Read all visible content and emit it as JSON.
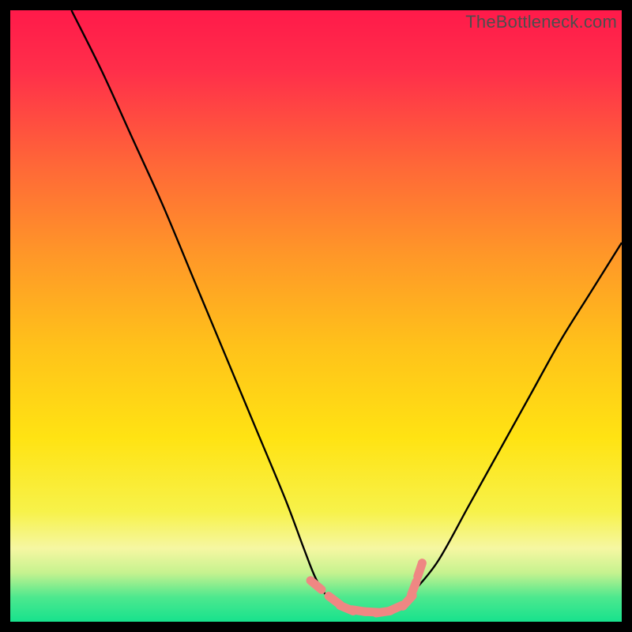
{
  "watermark": "TheBottleneck.com",
  "gradient": {
    "stops": [
      {
        "offset": 0.0,
        "color": "#ff1a4a"
      },
      {
        "offset": 0.1,
        "color": "#ff2f4a"
      },
      {
        "offset": 0.25,
        "color": "#ff6638"
      },
      {
        "offset": 0.4,
        "color": "#ff9728"
      },
      {
        "offset": 0.55,
        "color": "#ffc21a"
      },
      {
        "offset": 0.7,
        "color": "#ffe313"
      },
      {
        "offset": 0.82,
        "color": "#f7f24a"
      },
      {
        "offset": 0.88,
        "color": "#f6f7a2"
      },
      {
        "offset": 0.92,
        "color": "#c6f28f"
      },
      {
        "offset": 0.96,
        "color": "#4de88e"
      },
      {
        "offset": 1.0,
        "color": "#17e28d"
      }
    ]
  },
  "curve_color": "#000000",
  "marker_color": "#ef8783",
  "chart_data": {
    "type": "line",
    "title": "",
    "xlabel": "",
    "ylabel": "",
    "xlim": [
      0,
      100
    ],
    "ylim": [
      0,
      100
    ],
    "series": [
      {
        "name": "bottleneck-curve",
        "x": [
          10,
          15,
          20,
          25,
          30,
          35,
          40,
          45,
          48,
          50,
          52,
          55,
          58,
          60,
          62,
          64,
          66,
          70,
          75,
          80,
          85,
          90,
          95,
          100
        ],
        "y": [
          100,
          90,
          79,
          68,
          56,
          44,
          32,
          20,
          12,
          7,
          4,
          2,
          1.5,
          1.5,
          2,
          3,
          5,
          10,
          19,
          28,
          37,
          46,
          54,
          62
        ]
      }
    ],
    "markers": {
      "name": "highlight-points",
      "x": [
        50,
        53,
        55,
        57,
        59,
        61,
        63,
        65,
        66,
        67
      ],
      "y": [
        6,
        3.5,
        2.2,
        1.8,
        1.6,
        1.6,
        2.2,
        3.4,
        5.5,
        8.5
      ]
    }
  }
}
